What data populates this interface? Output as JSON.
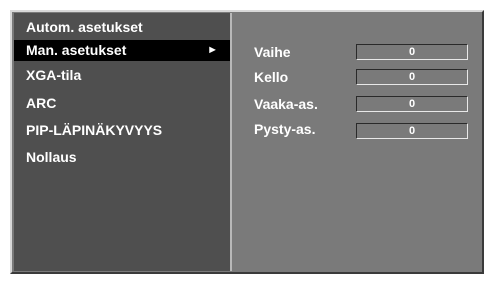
{
  "menu": {
    "items": [
      {
        "label": "Autom. asetukset"
      },
      {
        "label": "Man. asetukset",
        "selected": true,
        "arrow": "►"
      },
      {
        "label": "XGA-tila"
      },
      {
        "label": "ARC"
      },
      {
        "label": "PIP-LÄPINÄKYVYYS"
      },
      {
        "label": "Nollaus"
      }
    ]
  },
  "params": [
    {
      "label": "Vaihe",
      "value": "0"
    },
    {
      "label": "Kello",
      "value": "0"
    },
    {
      "label": "Vaaka-as.",
      "value": "0"
    },
    {
      "label": "Pysty-as.",
      "value": "0"
    }
  ],
  "colors": {
    "background": "#7a7a7a",
    "menu_panel": "#4f4f4f",
    "selected": "#000000",
    "text": "#ffffff"
  }
}
